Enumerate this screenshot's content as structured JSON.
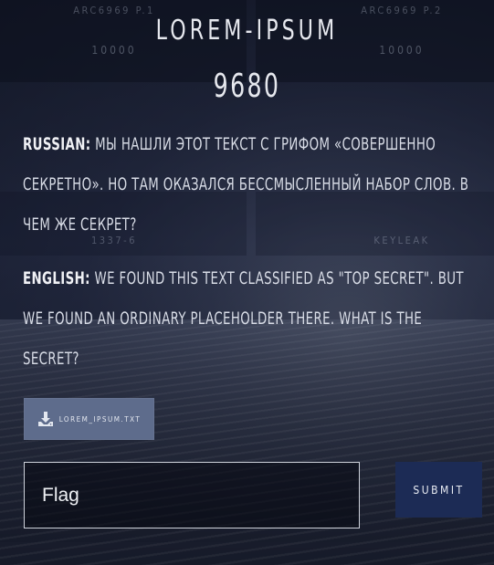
{
  "background": {
    "tiles": [
      {
        "label": "ARC6969 P.1",
        "value": "10000"
      },
      {
        "label": "ARC6969 P.2",
        "value": "10000"
      },
      {
        "label": "1337-6",
        "value": ""
      },
      {
        "label": "KEYLEAK",
        "value": ""
      }
    ]
  },
  "challenge": {
    "title": "LOREM-IPSUM",
    "points": "9680",
    "russian_label": "RUSSIAN:",
    "russian_text": " Мы нашли этот текст с грифом «совершенно секретно». Но там оказался бессмысленный набор слов. В чем же секрет?",
    "english_label": "ENGLISH:",
    "english_text": " We found this text classified as \"Top Secret\". But we found an ordinary placeholder there. What is the secret?",
    "file": {
      "name": "lorem_ipsum.txt",
      "icon": "download-icon"
    }
  },
  "form": {
    "flag_placeholder": "Flag",
    "submit_label": "SUBMIT"
  },
  "colors": {
    "download_button": "#5e6c8c",
    "submit_button": "#1c2b55"
  }
}
